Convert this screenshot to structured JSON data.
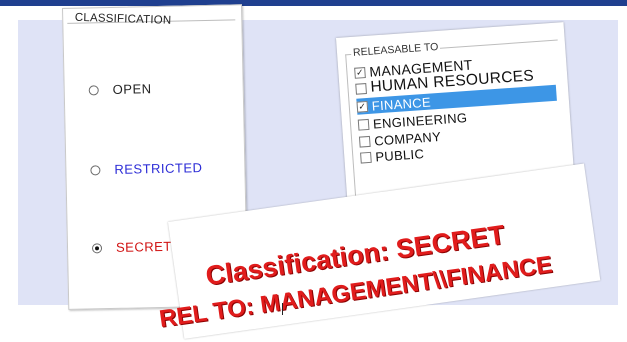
{
  "classification_panel": {
    "title": "CLASSIFICATION",
    "options": [
      {
        "label": "OPEN",
        "selected": false,
        "color": "#222222"
      },
      {
        "label": "RESTRICTED",
        "selected": false,
        "color": "#2b2bd6"
      },
      {
        "label": "SECRET",
        "selected": true,
        "color": "#d01010"
      }
    ]
  },
  "releasable_panel": {
    "title": "RELEASABLE TO",
    "items": [
      {
        "label": "MANAGEMENT",
        "checked": true,
        "highlighted": false
      },
      {
        "label": "HUMAN RESOURCES",
        "checked": false,
        "highlighted": false
      },
      {
        "label": "FINANCE",
        "checked": true,
        "highlighted": true
      },
      {
        "label": "ENGINEERING",
        "checked": false,
        "highlighted": false
      },
      {
        "label": "COMPANY",
        "checked": false,
        "highlighted": false
      },
      {
        "label": "PUBLIC",
        "checked": false,
        "highlighted": false
      }
    ],
    "highlight_color": "#3d96e6"
  },
  "banner": {
    "line1": "Classification: SECRET",
    "line2": "REL TO: MANAGEMENT\\\\FINANCE",
    "color": "#e11c1c"
  },
  "colors": {
    "top_bar": "#1f3f8f",
    "background_panel": "#dfe3f6"
  }
}
